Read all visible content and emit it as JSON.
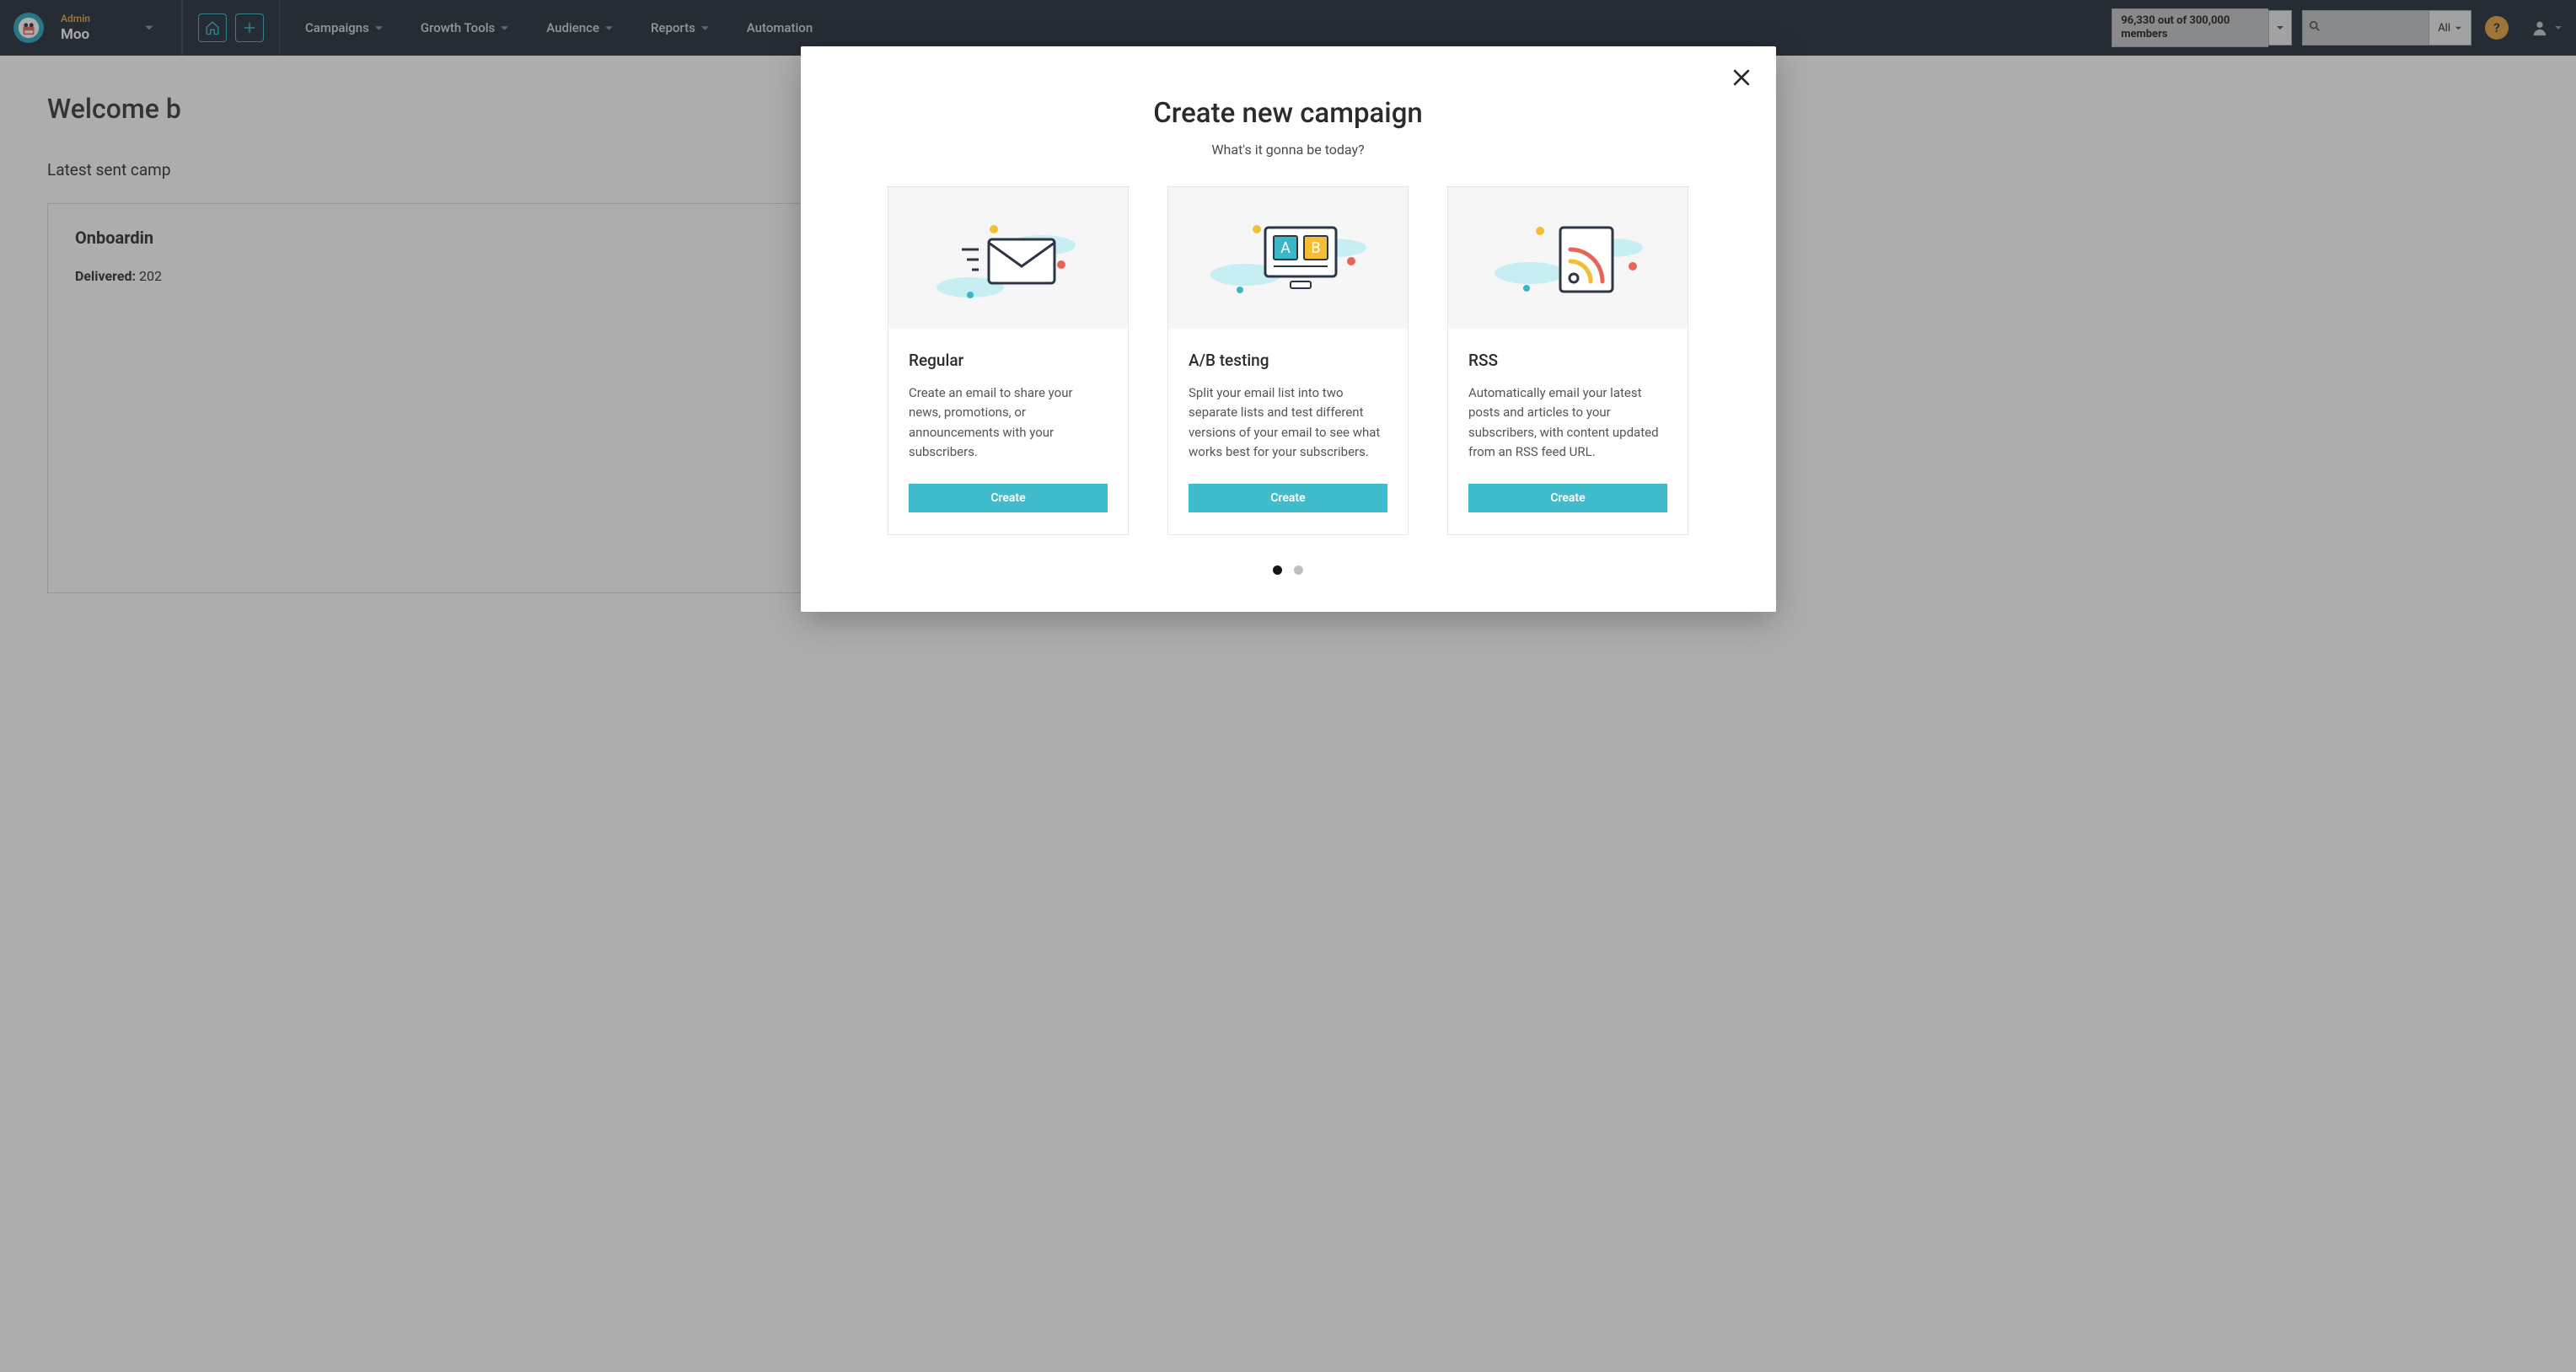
{
  "header": {
    "admin_label": "Admin",
    "org_name": "Moo",
    "nav": {
      "campaigns": "Campaigns",
      "growth_tools": "Growth Tools",
      "audience": "Audience",
      "reports": "Reports",
      "automation": "Automation"
    },
    "members_box": "96,330 out of 300,000 members",
    "search": {
      "placeholder": "",
      "scope": "All"
    },
    "help_glyph": "?"
  },
  "page": {
    "welcome_partial": "Welcome b",
    "latest_partial": "Latest sent camp",
    "card_title_partial": "Onboardin",
    "delivered_label": "Delivered:",
    "delivered_value_partial": "202"
  },
  "modal": {
    "title": "Create new campaign",
    "tagline": "What's it gonna be today?",
    "cards": [
      {
        "title": "Regular",
        "desc": "Create an email to share your news, promotions, or announcements with your subscribers.",
        "cta": "Create"
      },
      {
        "title": "A/B testing",
        "desc": "Split your email list into two separate lists and test different versions of your email to see what works best for your subscribers.",
        "cta": "Create"
      },
      {
        "title": "RSS",
        "desc": "Automatically email your latest posts and articles to your subscribers, with content updated from an RSS feed URL.",
        "cta": "Create"
      }
    ]
  }
}
